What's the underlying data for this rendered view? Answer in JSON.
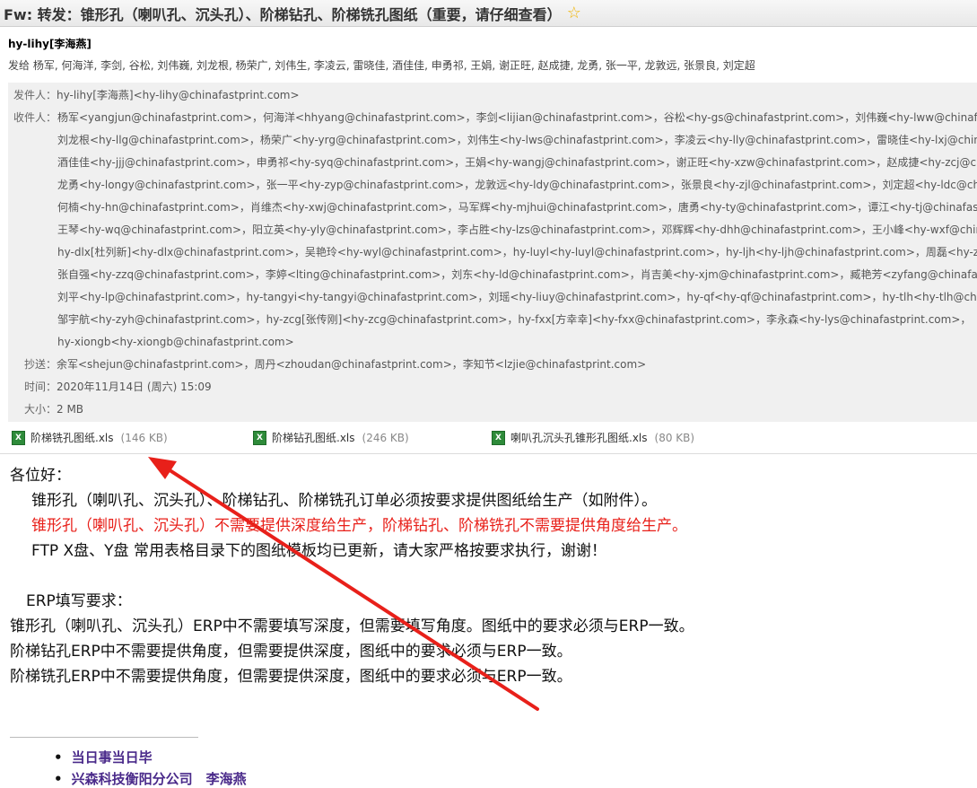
{
  "subject": "Fw: 转发：锥形孔（喇叭孔、沉头孔）、阶梯钻孔、阶梯铣孔图纸（重要，请仔细查看）",
  "sender_display": "hy-lihy[李海燕]",
  "sent_to_line": "发给 杨军, 何海洋, 李剑, 谷松, 刘伟巍, 刘龙根, 杨荣广, 刘伟生, 李凌云, 雷晓佳, 酒佳佳, 申勇祁, 王娟, 谢正旺, 赵成捷, 龙勇, 张一平, 龙敦远, 张景良, 刘定超",
  "headers": {
    "from_label": "发件人：",
    "from_value": "hy-lihy[李海燕]<hy-lihy@chinafastprint.com>",
    "to_label": "收件人：",
    "to_lines": [
      "杨军<yangjun@chinafastprint.com>，何海洋<hhyang@chinafastprint.com>，李剑<lijian@chinafastprint.com>，谷松<hy-gs@chinafastprint.com>，刘伟巍<hy-lww@chinafastprint.com>，",
      "刘龙根<hy-llg@chinafastprint.com>，杨荣广<hy-yrg@chinafastprint.com>，刘伟生<hy-lws@chinafastprint.com>，李凌云<hy-lly@chinafastprint.com>，雷晓佳<hy-lxj@chinafastprint.com>，",
      "酒佳佳<hy-jjj@chinafastprint.com>，申勇祁<hy-syq@chinafastprint.com>，王娟<hy-wangj@chinafastprint.com>，谢正旺<hy-xzw@chinafastprint.com>，赵成捷<hy-zcj@chinafastprint.com>，",
      "龙勇<hy-longy@chinafastprint.com>，张一平<hy-zyp@chinafastprint.com>，龙敦远<hy-ldy@chinafastprint.com>，张景良<hy-zjl@chinafastprint.com>，刘定超<hy-ldc@chinafastprint.com>，",
      "何楠<hy-hn@chinafastprint.com>，肖维杰<hy-xwj@chinafastprint.com>，马军辉<hy-mjhui@chinafastprint.com>，唐勇<hy-ty@chinafastprint.com>，谭江<hy-tj@chinafastprint.com>，",
      "王琴<hy-wq@chinafastprint.com>，阳立英<hy-yly@chinafastprint.com>，李占胜<hy-lzs@chinafastprint.com>，邓辉辉<hy-dhh@chinafastprint.com>，王小峰<hy-wxf@chinafastprint.com>，",
      "hy-dlx[杜列新]<hy-dlx@chinafastprint.com>，吴艳玲<hy-wyl@chinafastprint.com>，hy-luyl<hy-luyl@chinafastprint.com>，hy-ljh<hy-ljh@chinafastprint.com>，周磊<hy-zl@chinafastprint.com>，",
      "张自强<hy-zzq@chinafastprint.com>，李婷<lting@chinafastprint.com>，刘东<hy-ld@chinafastprint.com>，肖吉美<hy-xjm@chinafastprint.com>，臧艳芳<zyfang@chinafastprint.com>，",
      "刘平<hy-lp@chinafastprint.com>，hy-tangyi<hy-tangyi@chinafastprint.com>，刘瑶<hy-liuy@chinafastprint.com>，hy-qf<hy-qf@chinafastprint.com>，hy-tlh<hy-tlh@chinafastprint.com>，",
      "邹宇航<hy-zyh@chinafastprint.com>，hy-zcg[张传刚]<hy-zcg@chinafastprint.com>，hy-fxx[方幸幸]<hy-fxx@chinafastprint.com>，李永森<hy-lys@chinafastprint.com>，",
      "hy-xiongb<hy-xiongb@chinafastprint.com>"
    ],
    "cc_label": "抄送：",
    "cc_value": "余军<shejun@chinafastprint.com>，周丹<zhoudan@chinafastprint.com>，李知节<lzjie@chinafastprint.com>",
    "time_label": "时间：",
    "time_value": "2020年11月14日 (周六) 15:09",
    "size_label": "大小：",
    "size_value": "2 MB"
  },
  "attachments": [
    {
      "name": "阶梯铣孔图纸.xls",
      "size": "(146 KB)",
      "icon": "xls-file-icon"
    },
    {
      "name": "阶梯钻孔图纸.xls",
      "size": "(246 KB)",
      "icon": "xls-file-icon"
    },
    {
      "name": "喇叭孔沉头孔锥形孔图纸.xls",
      "size": "(80 KB)",
      "icon": "xls-file-icon"
    }
  ],
  "body": {
    "greeting": "各位好：",
    "line1": "锥形孔（喇叭孔、沉头孔）、阶梯钻孔、阶梯铣孔订单必须按要求提供图纸给生产（如附件）。",
    "line2_red": "锥形孔（喇叭孔、沉头孔）不需要提供深度给生产，阶梯钻孔、阶梯铣孔不需要提供角度给生产。",
    "line3": "FTP X盘、Y盘 常用表格目录下的图纸模板均已更新，请大家严格按要求执行，谢谢！",
    "erp_title": "ERP填写要求：",
    "erp1": "锥形孔（喇叭孔、沉头孔）ERP中不需要填写深度，但需要填写角度。图纸中的要求必须与ERP一致。",
    "erp2": "阶梯钻孔ERP中不需要提供角度，但需要提供深度，图纸中的要求必须与ERP一致。",
    "erp3": "阶梯铣孔ERP中不需要提供角度，但需要提供深度，图纸中的要求必须与ERP一致。"
  },
  "signature": {
    "line1": "当日事当日毕",
    "line2": "兴森科技衡阳分公司　李海燕"
  },
  "colors": {
    "accent_red": "#e8201a",
    "signature_purple": "#4a2a8a",
    "arrow_red": "#e8201a"
  }
}
